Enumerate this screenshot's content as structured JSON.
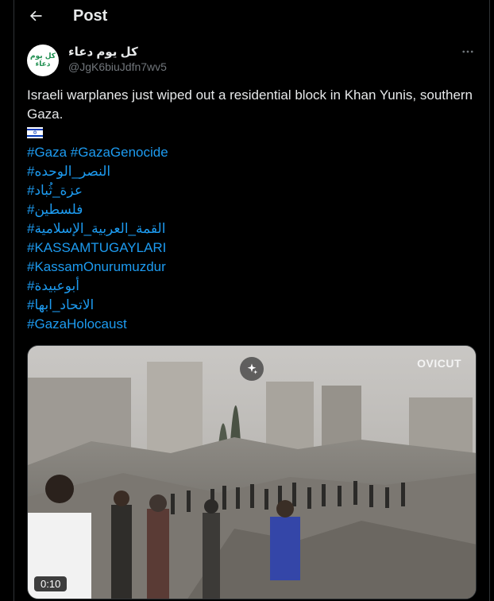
{
  "header": {
    "title": "Post"
  },
  "author": {
    "display_name": "كل يوم دعاء",
    "handle": "@JgK6biuJdfn7wv5",
    "avatar_text": "كل يوم دعاء"
  },
  "post": {
    "text": "Israeli warplanes just wiped out a residential block in Khan Yunis, southern Gaza.",
    "hashtags": [
      "#Gaza #GazaGenocide",
      "#النصر_الوحده",
      "#عزة_ثُباد",
      "#فلسطين",
      "#القمة_العربية_الإسلامية",
      "#KASSAMTUGAYLARI",
      "#KassamOnurumuzdur",
      "#أبوعبيدة",
      "#الاتحاد_ابها",
      "#GazaHolocaust"
    ]
  },
  "media": {
    "watermark": "OVICUT",
    "timestamp": "0:10",
    "description_icon": "sparkle-icon"
  },
  "colors": {
    "accent": "#1d9bf0",
    "background": "#000000",
    "muted": "#71767b",
    "text": "#e7e9ea"
  }
}
